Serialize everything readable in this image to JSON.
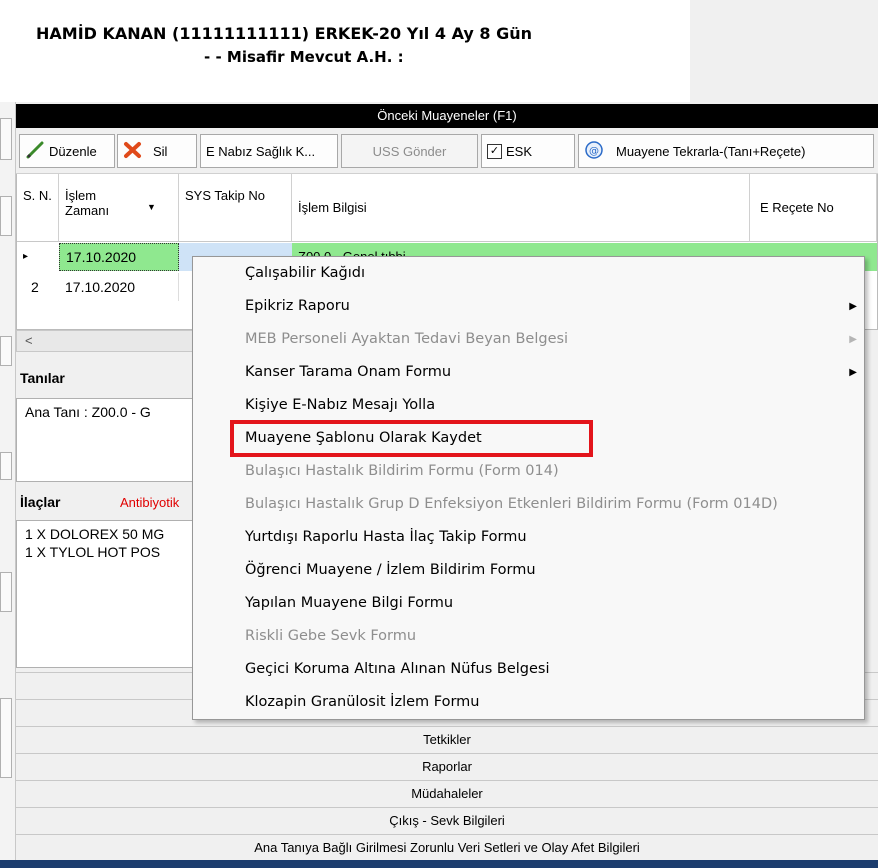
{
  "patient": {
    "line1": "HAMİD KANAN (11111111111)  ERKEK-20 Yıl 4 Ay 8 Gün",
    "line2": "-  - Misafir Mevcut A.H. :"
  },
  "panel_title": "Önceki Muayeneler (F1)",
  "toolbar": {
    "edit_label": "Düzenle",
    "delete_label": "Sil",
    "enabiz_label": "E Nabız Sağlık K...",
    "uss_label": "USS Gönder",
    "esk_label": "ESK",
    "esk_checked": true,
    "repeat_label": "Muayene Tekrarla-(Tanı+Reçete)"
  },
  "grid": {
    "columns": [
      "S. N.",
      "İşlem Zamanı",
      "SYS Takip No",
      "İşlem Bilgisi",
      "E Reçete No"
    ],
    "rows": [
      {
        "marker": "▸",
        "date": "17.10.2020",
        "info_partial": "Z00.0 - Genel tıbbi"
      },
      {
        "marker": "2",
        "date": "17.10.2020",
        "info_partial": ""
      }
    ]
  },
  "sections": {
    "tanilar_label": "Tanılar",
    "tanilar_text": "Ana Tanı : Z00.0 - G",
    "ilaclar_label": "İlaçlar",
    "antibiyotik_label": "Antibiyotik",
    "ilaclar_lines": [
      "1 X DOLOREX 50 MG",
      "1 X TYLOL HOT POS"
    ]
  },
  "bottom_bars": [
    "Tetkikler",
    "Raporlar",
    "Müdahaleler",
    "Çıkış - Sevk Bilgileri",
    "Ana Tanıya Bağlı Girilmesi Zorunlu Veri Setleri ve Olay Afet Bilgileri"
  ],
  "context_menu": {
    "items": [
      {
        "label": "Çalışabilir Kağıdı",
        "enabled": true,
        "submenu": false
      },
      {
        "label": "Epikriz Raporu",
        "enabled": true,
        "submenu": true
      },
      {
        "label": "MEB Personeli Ayaktan Tedavi Beyan Belgesi",
        "enabled": false,
        "submenu": true
      },
      {
        "label": "Kanser Tarama Onam Formu",
        "enabled": true,
        "submenu": true
      },
      {
        "label": "Kişiye E-Nabız Mesajı Yolla",
        "enabled": true,
        "submenu": false
      },
      {
        "label": "Muayene Şablonu Olarak Kaydet",
        "enabled": true,
        "submenu": false,
        "highlighted": true
      },
      {
        "label": "Bulaşıcı Hastalık Bildirim Formu (Form 014)",
        "enabled": false,
        "submenu": false
      },
      {
        "label": "Bulaşıcı Hastalık Grup D Enfeksiyon Etkenleri Bildirim Formu (Form 014D)",
        "enabled": false,
        "submenu": false
      },
      {
        "label": "Yurtdışı Raporlu Hasta İlaç Takip Formu",
        "enabled": true,
        "submenu": false
      },
      {
        "label": "Öğrenci Muayene / İzlem Bildirim Formu",
        "enabled": true,
        "submenu": false
      },
      {
        "label": "Yapılan Muayene Bilgi Formu",
        "enabled": true,
        "submenu": false
      },
      {
        "label": "Riskli Gebe Sevk Formu",
        "enabled": false,
        "submenu": false
      },
      {
        "label": "Geçici Koruma Altına Alınan Nüfus Belgesi",
        "enabled": true,
        "submenu": false
      },
      {
        "label": "Klozapin Granülosit İzlem Formu",
        "enabled": true,
        "submenu": false
      }
    ]
  },
  "colors": {
    "selected_row": "#8fe88f",
    "highlight_box": "#e3141b",
    "title_bar": "#000000",
    "antibiyotik": "#e00000"
  },
  "icons": [
    "pencil-icon",
    "delete-x-icon",
    "refresh-icon",
    "expand-arrow-icon",
    "sort-arrow-icon"
  ]
}
